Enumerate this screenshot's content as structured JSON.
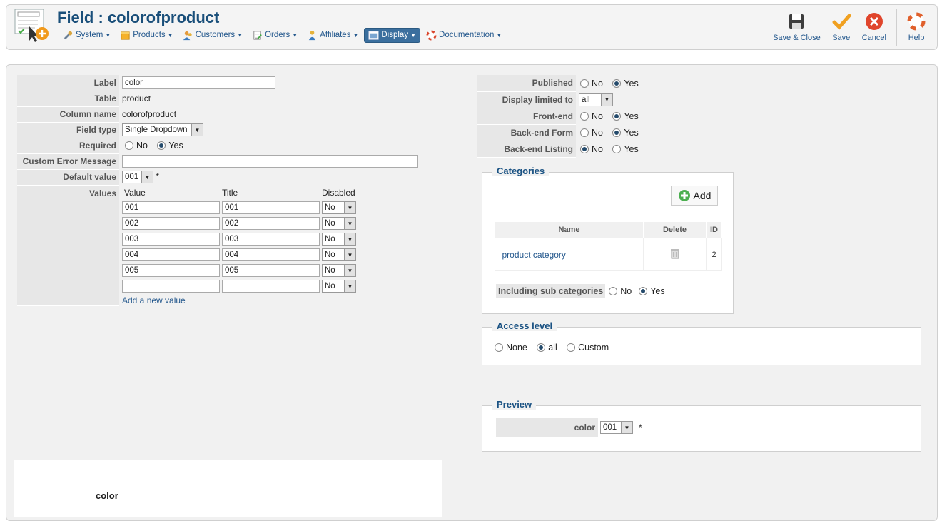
{
  "header": {
    "title": "Field : colorofproduct",
    "menu": [
      {
        "label": "System",
        "icon": "wrench-icon"
      },
      {
        "label": "Products",
        "icon": "products-icon"
      },
      {
        "label": "Customers",
        "icon": "customers-icon"
      },
      {
        "label": "Orders",
        "icon": "orders-icon"
      },
      {
        "label": "Affiliates",
        "icon": "affiliates-icon"
      },
      {
        "label": "Display",
        "icon": "display-icon",
        "active": true
      },
      {
        "label": "Documentation",
        "icon": "lifebuoy-icon"
      }
    ],
    "toolbar": {
      "save_close": "Save & Close",
      "save": "Save",
      "cancel": "Cancel",
      "help": "Help"
    }
  },
  "form": {
    "label": {
      "label": "Label",
      "value": "color"
    },
    "table": {
      "label": "Table",
      "value": "product"
    },
    "column": {
      "label": "Column name",
      "value": "colorofproduct"
    },
    "field_type": {
      "label": "Field type",
      "value": "Single Dropdown"
    },
    "required": {
      "label": "Required",
      "no": "No",
      "yes": "Yes",
      "selected": "Yes"
    },
    "custom_error": {
      "label": "Custom Error Message",
      "value": ""
    },
    "default_value": {
      "label": "Default value",
      "value": "001",
      "star": "*"
    },
    "values": {
      "label": "Values",
      "col_value": "Value",
      "col_title": "Title",
      "col_disabled": "Disabled",
      "rows": [
        {
          "value": "001",
          "title": "001",
          "disabled": "No"
        },
        {
          "value": "002",
          "title": "002",
          "disabled": "No"
        },
        {
          "value": "003",
          "title": "003",
          "disabled": "No"
        },
        {
          "value": "004",
          "title": "004",
          "disabled": "No"
        },
        {
          "value": "005",
          "title": "005",
          "disabled": "No"
        },
        {
          "value": "",
          "title": "",
          "disabled": "No"
        }
      ],
      "add_new": "Add a new value"
    }
  },
  "settings": {
    "published": {
      "label": "Published",
      "no": "No",
      "yes": "Yes"
    },
    "display_limited": {
      "label": "Display limited to",
      "value": "all"
    },
    "frontend": {
      "label": "Front-end",
      "no": "No",
      "yes": "Yes"
    },
    "backend_form": {
      "label": "Back-end Form",
      "no": "No",
      "yes": "Yes"
    },
    "backend_listing": {
      "label": "Back-end Listing",
      "no": "No",
      "yes": "Yes"
    }
  },
  "categories": {
    "legend": "Categories",
    "add": "Add",
    "headers": {
      "name": "Name",
      "delete": "Delete",
      "id": "ID"
    },
    "rows": [
      {
        "name": "product category",
        "id": "2"
      }
    ],
    "include_sub": {
      "label": "Including sub categories",
      "no": "No",
      "yes": "Yes"
    }
  },
  "access": {
    "legend": "Access level",
    "none": "None",
    "all": "all",
    "custom": "Custom"
  },
  "preview": {
    "legend": "Preview",
    "label": "color",
    "value": "001",
    "star": "*"
  },
  "bottom": {
    "label": "color"
  }
}
